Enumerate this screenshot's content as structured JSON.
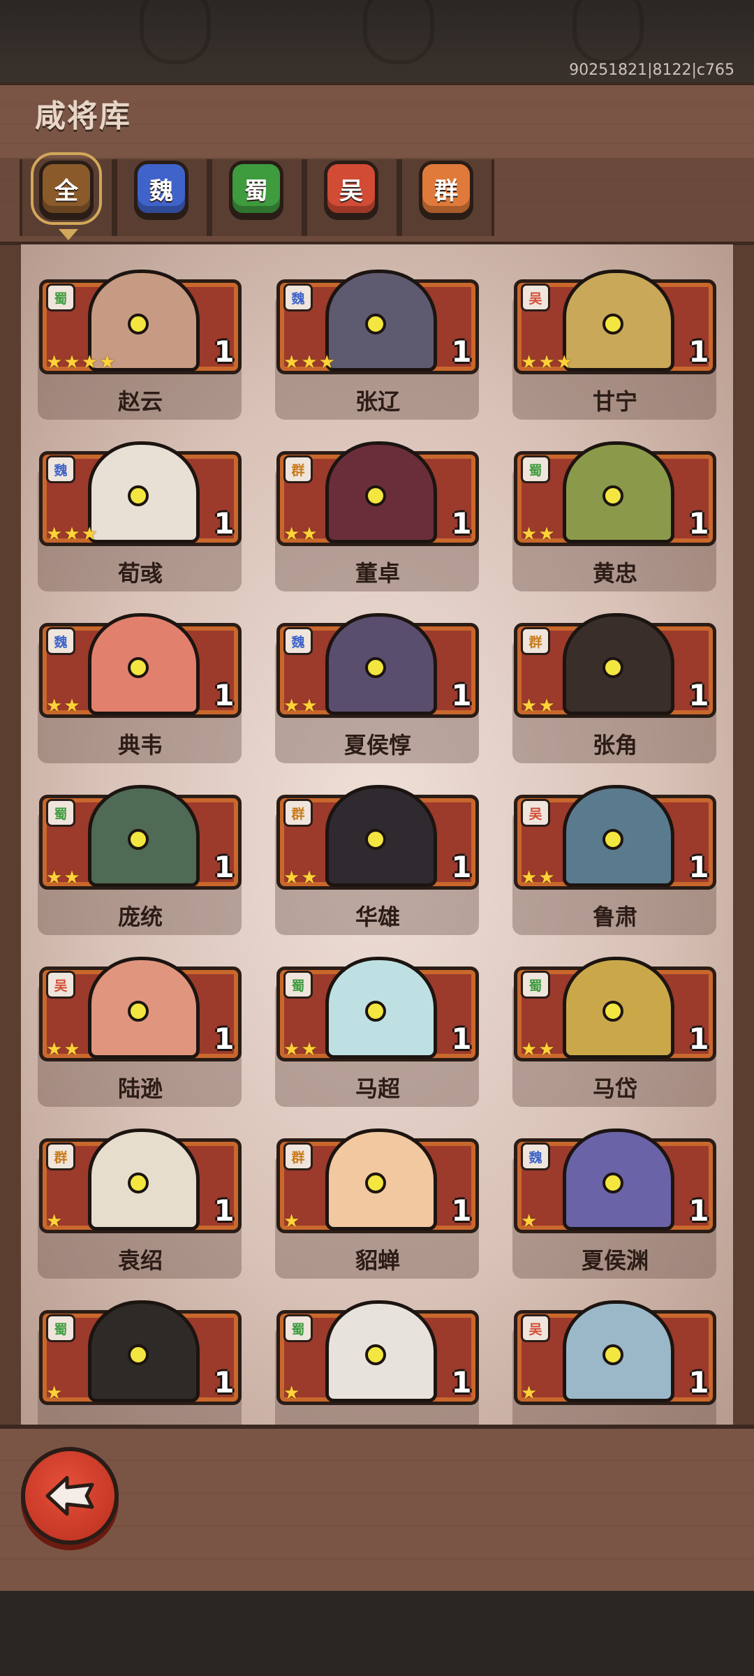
{
  "window": {
    "title": "咸将库",
    "build_id": "90251821|8122|c765"
  },
  "tabs": [
    {
      "label": "全",
      "color": "#8a5a2a",
      "active": true
    },
    {
      "label": "魏",
      "color": "#3f63c9",
      "active": false
    },
    {
      "label": "蜀",
      "color": "#3e9b3e",
      "active": false
    },
    {
      "label": "吴",
      "color": "#d24b35",
      "active": false
    },
    {
      "label": "群",
      "color": "#e07a3a",
      "active": false
    }
  ],
  "faction_colors": {
    "魏": "#3f63c9",
    "蜀": "#3e9b3e",
    "吴": "#d24b35",
    "群": "#c87a1a"
  },
  "heroes": [
    {
      "name": "赵云",
      "faction": "蜀",
      "stars": 4,
      "level": "1",
      "skin": "#c79b83"
    },
    {
      "name": "张辽",
      "faction": "魏",
      "stars": 3,
      "level": "1",
      "skin": "#5e5a70"
    },
    {
      "name": "甘宁",
      "faction": "吴",
      "stars": 3,
      "level": "1",
      "skin": "#c9a85a"
    },
    {
      "name": "荀彧",
      "faction": "魏",
      "stars": 3,
      "level": "1",
      "skin": "#e8e0d4"
    },
    {
      "name": "董卓",
      "faction": "群",
      "stars": 2,
      "level": "1",
      "skin": "#6a2e3a"
    },
    {
      "name": "黄忠",
      "faction": "蜀",
      "stars": 2,
      "level": "1",
      "skin": "#8a9a4a"
    },
    {
      "name": "典韦",
      "faction": "魏",
      "stars": 2,
      "level": "1",
      "skin": "#e2806e"
    },
    {
      "name": "夏侯惇",
      "faction": "魏",
      "stars": 2,
      "level": "1",
      "skin": "#5a4e6e"
    },
    {
      "name": "张角",
      "faction": "群",
      "stars": 2,
      "level": "1",
      "skin": "#3a2e2a"
    },
    {
      "name": "庞统",
      "faction": "蜀",
      "stars": 2,
      "level": "1",
      "skin": "#4f6a55"
    },
    {
      "name": "华雄",
      "faction": "群",
      "stars": 2,
      "level": "1",
      "skin": "#2e2a30"
    },
    {
      "name": "鲁肃",
      "faction": "吴",
      "stars": 2,
      "level": "1",
      "skin": "#5a7a8e"
    },
    {
      "name": "陆逊",
      "faction": "吴",
      "stars": 2,
      "level": "1",
      "skin": "#e0957e"
    },
    {
      "name": "马超",
      "faction": "蜀",
      "stars": 2,
      "level": "1",
      "skin": "#bfe0e2"
    },
    {
      "name": "马岱",
      "faction": "蜀",
      "stars": 2,
      "level": "1",
      "skin": "#caa84a"
    },
    {
      "name": "袁绍",
      "faction": "群",
      "stars": 1,
      "level": "1",
      "skin": "#e6ddcc"
    },
    {
      "name": "貂蝉",
      "faction": "群",
      "stars": 1,
      "level": "1",
      "skin": "#f2c8a0"
    },
    {
      "name": "夏侯渊",
      "faction": "魏",
      "stars": 1,
      "level": "1",
      "skin": "#6a63a8"
    },
    {
      "name": "",
      "faction": "蜀",
      "stars": 1,
      "level": "1",
      "skin": "#2e2a28"
    },
    {
      "name": "",
      "faction": "蜀",
      "stars": 1,
      "level": "1",
      "skin": "#e8e2dc"
    },
    {
      "name": "",
      "faction": "吴",
      "stars": 1,
      "level": "1",
      "skin": "#9ab8c8"
    }
  ],
  "back_icon": "back-arrow-icon"
}
